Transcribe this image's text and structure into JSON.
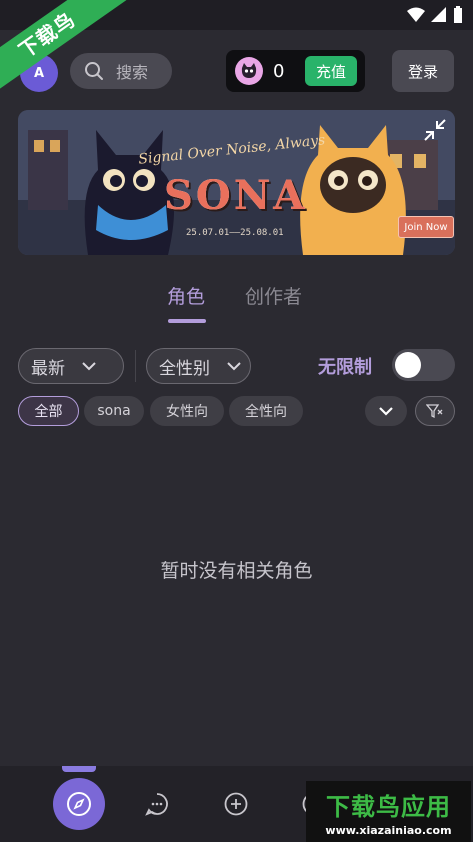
{
  "ribbon": {
    "text": "下载鸟"
  },
  "topbar": {
    "avatar_text": "A",
    "search_placeholder": "搜索",
    "coins": "0",
    "recharge_label": "充值",
    "login_label": "登录"
  },
  "banner": {
    "subtitle": "Signal Over Noise, Always",
    "title": "SONA",
    "dates": "25.07.01——25.08.01",
    "join_label": "Join Now"
  },
  "tabs": [
    {
      "label": "角色",
      "active": true
    },
    {
      "label": "创作者",
      "active": false
    }
  ],
  "filters": {
    "sort_value": "最新",
    "gender_value": "全性别",
    "unlimited_label": "无限制",
    "unlimited_enabled": false
  },
  "chips": [
    "全部",
    "sona",
    "女性向",
    "全性向"
  ],
  "empty_state": "暂时没有相关角色",
  "nav": {
    "items": [
      "discover-icon",
      "chat-icon",
      "create-icon",
      "more-icon"
    ],
    "active": "discover-icon"
  },
  "watermark": {
    "title": "下载鸟应用",
    "url": "www.xiazainiao.com"
  },
  "colors": {
    "accent": "#b39ddb",
    "recharge": "#29b36a",
    "ribbon": "#2fae55",
    "background": "#2b2a31"
  }
}
